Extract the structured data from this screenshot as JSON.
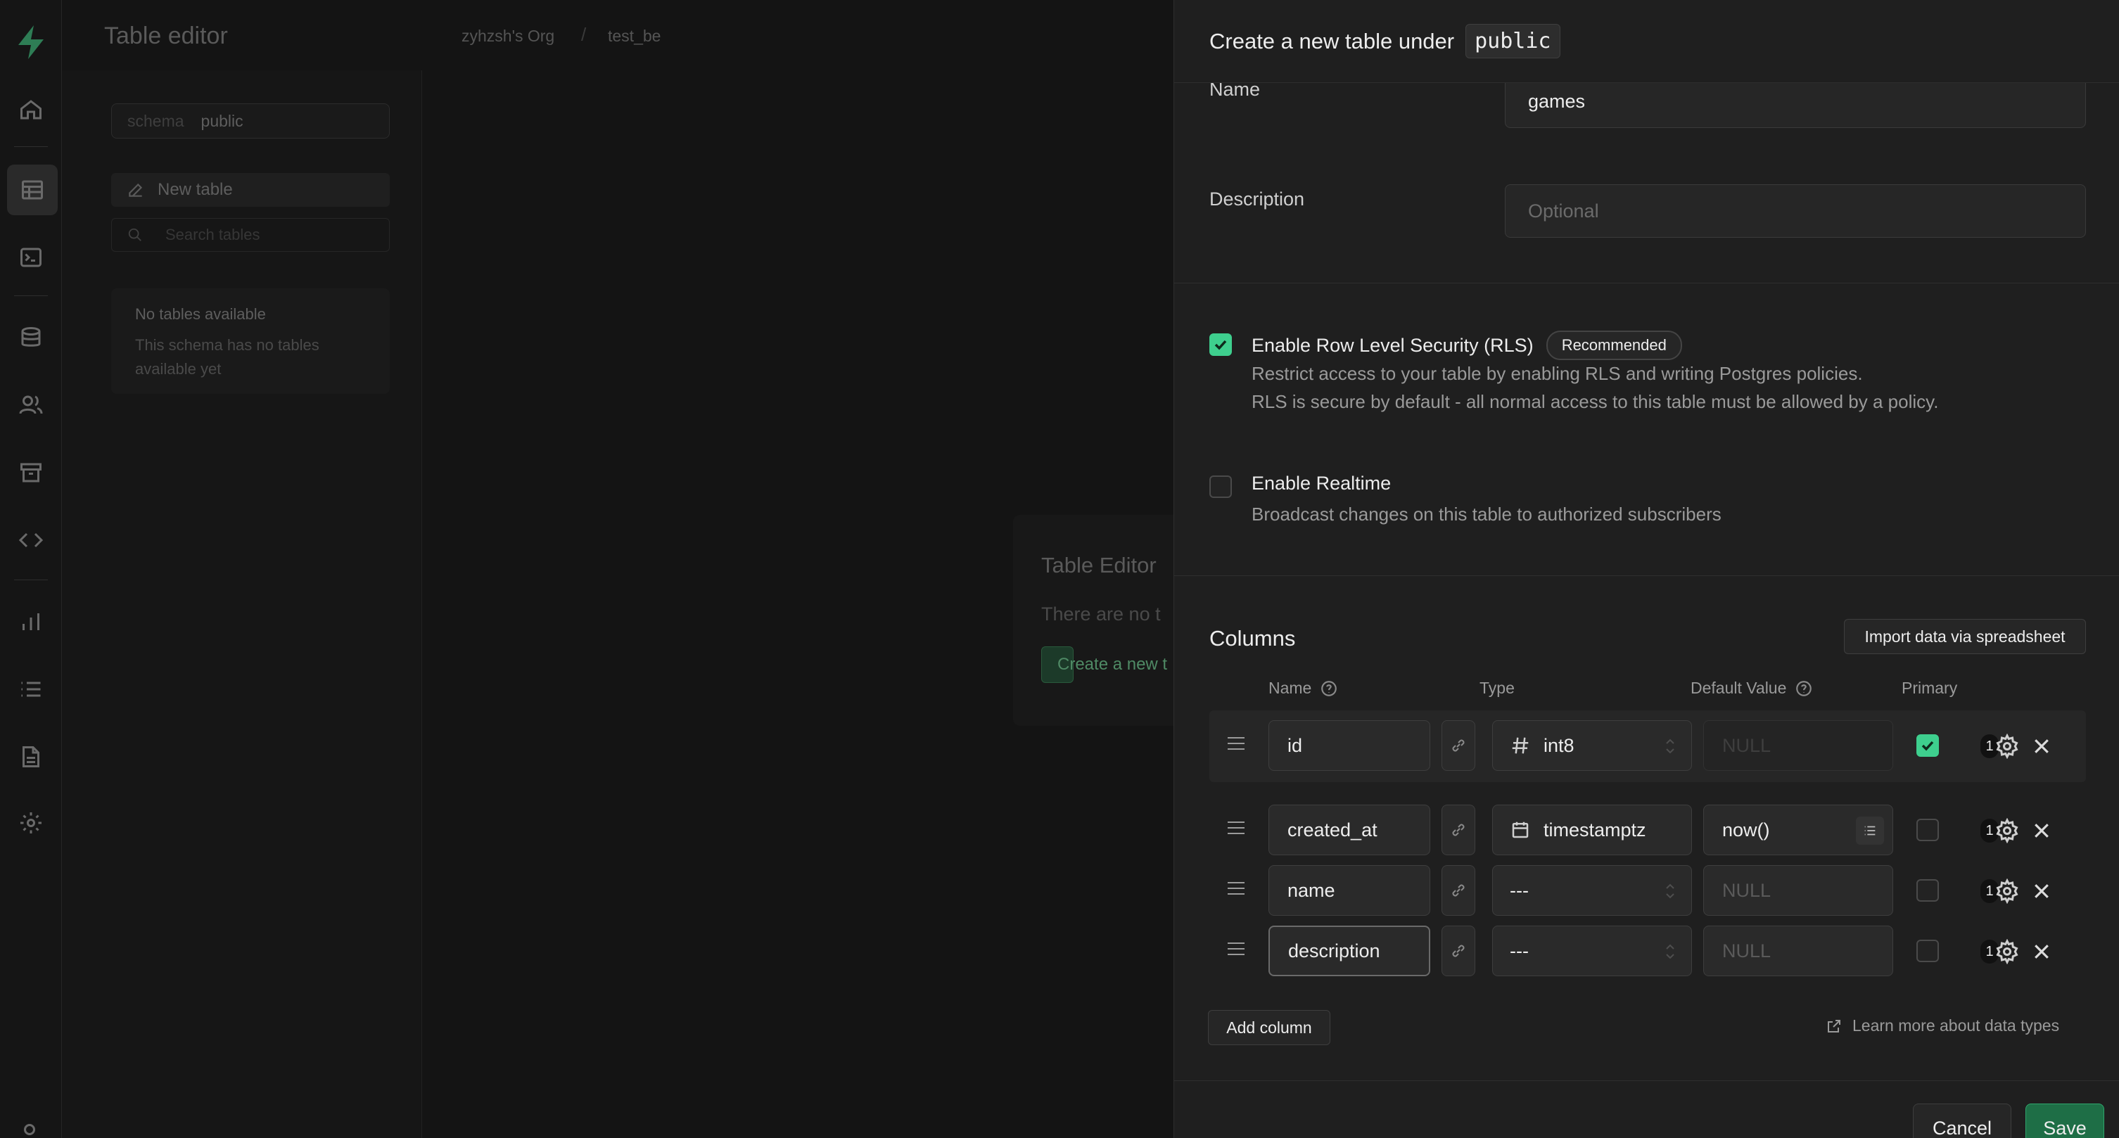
{
  "app": {
    "title": "Table editor",
    "breadcrumbs": [
      "zyhzsh's Org",
      "test_be"
    ]
  },
  "sidebar": {
    "schema_label": "schema",
    "schema_value": "public",
    "new_table_label": "New table",
    "search_placeholder": "Search tables",
    "empty_title": "No tables available",
    "empty_desc": "This schema has no tables available yet"
  },
  "bg_card": {
    "title": "Table Editor",
    "desc": "There are no t",
    "button": "Create a new t"
  },
  "panel": {
    "title": "Create a new table under",
    "schema": "public",
    "name_label": "Name",
    "name_value": "games",
    "description_label": "Description",
    "description_placeholder": "Optional",
    "rls": {
      "checked": true,
      "title": "Enable Row Level Security (RLS)",
      "badge": "Recommended",
      "desc1": "Restrict access to your table by enabling RLS and writing Postgres policies.",
      "desc2": "RLS is secure by default - all normal access to this table must be allowed by a policy."
    },
    "realtime": {
      "checked": false,
      "title": "Enable Realtime",
      "desc": "Broadcast changes on this table to authorized subscribers"
    },
    "columns": {
      "heading": "Columns",
      "import_button": "Import data via spreadsheet",
      "headers": {
        "name": "Name",
        "type": "Type",
        "default": "Default Value",
        "primary": "Primary"
      },
      "rows": [
        {
          "name": "id",
          "type": "int8",
          "type_icon": "hash-icon",
          "default": "NULL",
          "default_placeholder": true,
          "primary": true,
          "count": "1"
        },
        {
          "name": "created_at",
          "type": "timestamptz",
          "type_icon": "calendar-icon",
          "default": "now()",
          "default_placeholder": false,
          "primary": false,
          "count": "1"
        },
        {
          "name": "name",
          "type": "---",
          "type_icon": "",
          "default": "NULL",
          "default_placeholder": true,
          "primary": false,
          "count": "1"
        },
        {
          "name": "description",
          "type": "---",
          "type_icon": "",
          "default": "NULL",
          "default_placeholder": true,
          "primary": false,
          "count": "1"
        }
      ],
      "add_column": "Add column",
      "learn_more": "Learn more about data types"
    },
    "footer": {
      "cancel": "Cancel",
      "save": "Save"
    }
  },
  "colors": {
    "accent": "#3ecf8e",
    "save_bg": "#1e6e46"
  }
}
